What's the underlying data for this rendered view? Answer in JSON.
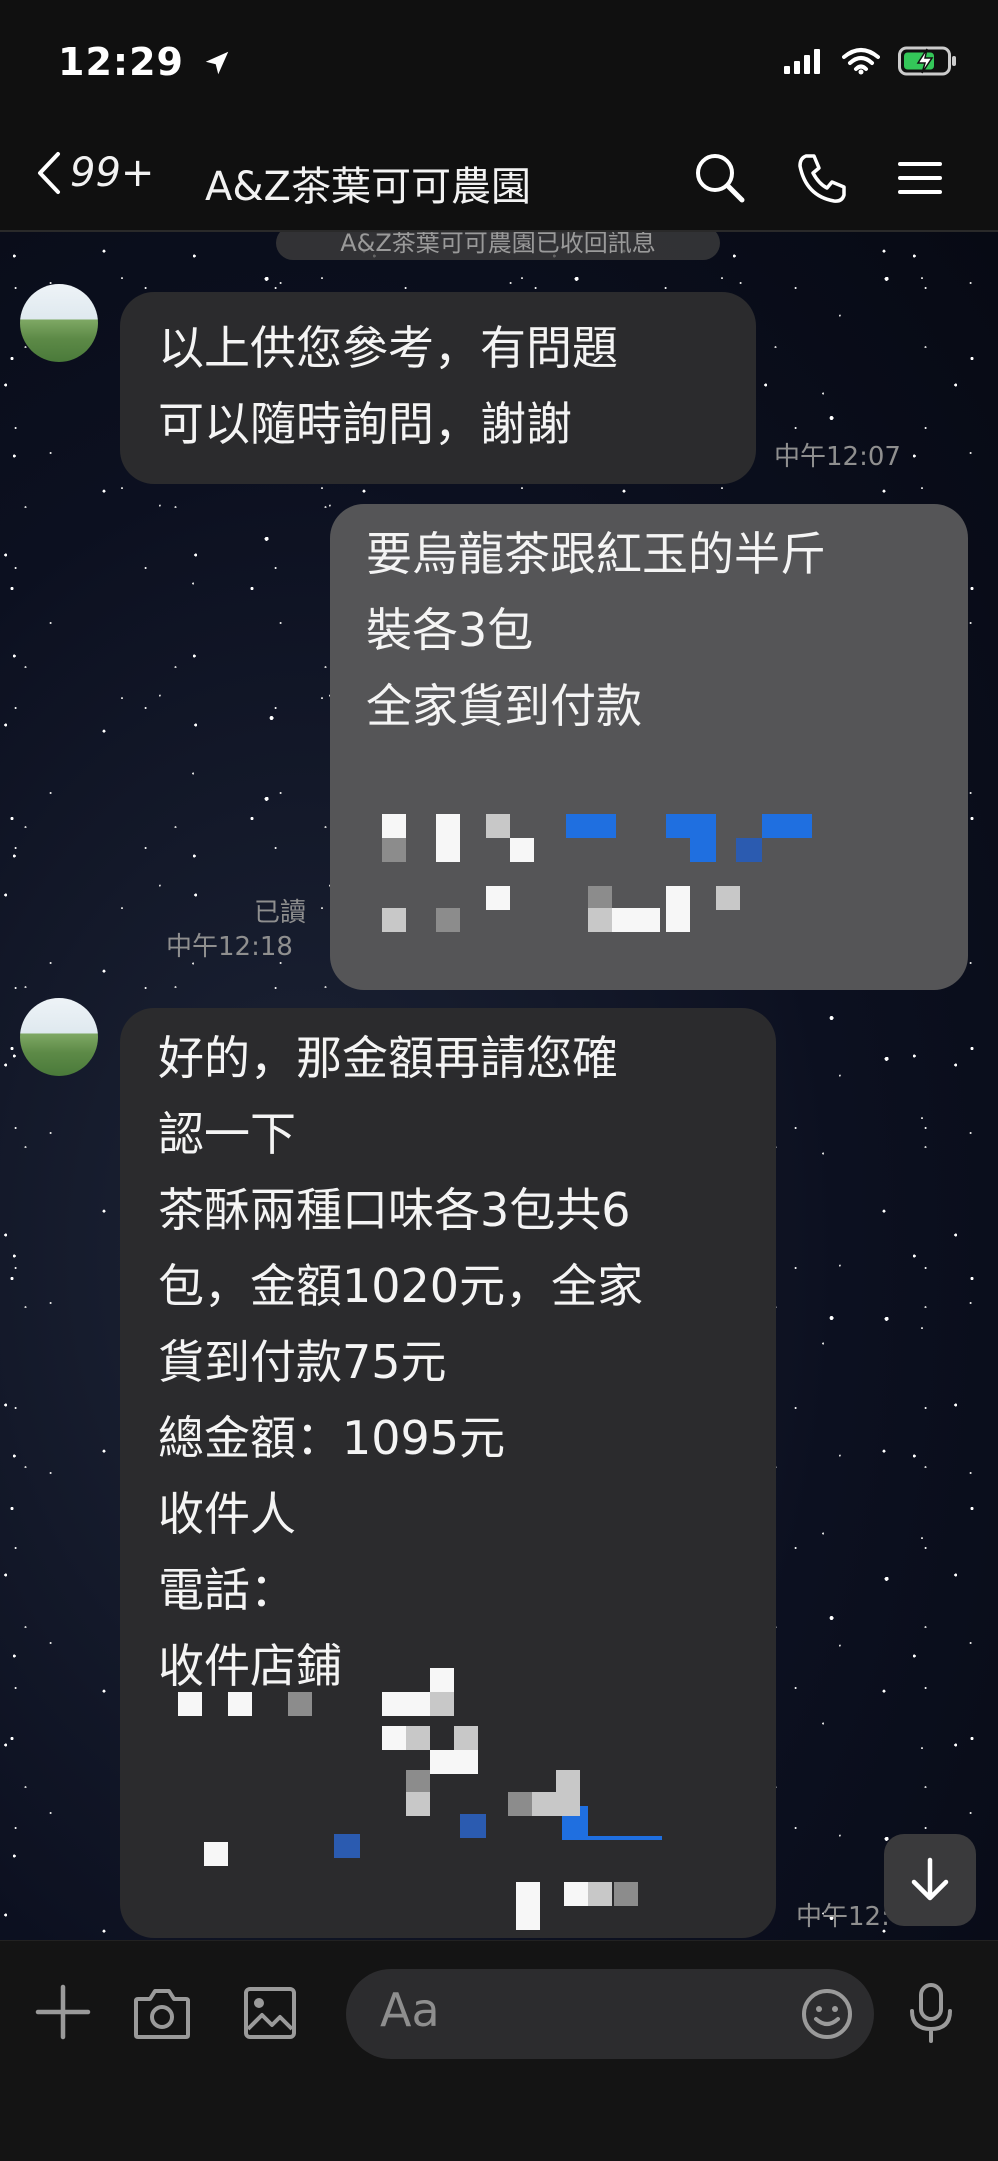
{
  "status_bar": {
    "time": "12:29"
  },
  "header": {
    "back_count": "99+",
    "title": "A&Z茶葉可可農園"
  },
  "chat": {
    "recall_notice": "A&Z茶葉可可農園已收回訊息",
    "messages": [
      {
        "lines": [
          "以上供您參考，有問題",
          "可以隨時詢問，謝謝"
        ],
        "time": "中午12:07"
      },
      {
        "lines": [
          "要烏龍茶跟紅玉的半斤",
          "裝各3包",
          "全家貨到付款"
        ],
        "read": "已讀",
        "time": "中午12:18"
      },
      {
        "lines": [
          "好的，那金額再請您確",
          "認一下",
          "茶酥兩種口味各3包共6",
          "包，金額1020元，全家",
          "貨到付款75元",
          "總金額：1095元",
          "收件人",
          "電話：",
          "收件店鋪"
        ],
        "time": "中午12:"
      }
    ]
  },
  "composer": {
    "placeholder": "Aa"
  },
  "colors": {
    "outgoing_bubble": "#555557",
    "incoming_bubble": "#2b2b2d",
    "battery_charging": "#34c759"
  }
}
